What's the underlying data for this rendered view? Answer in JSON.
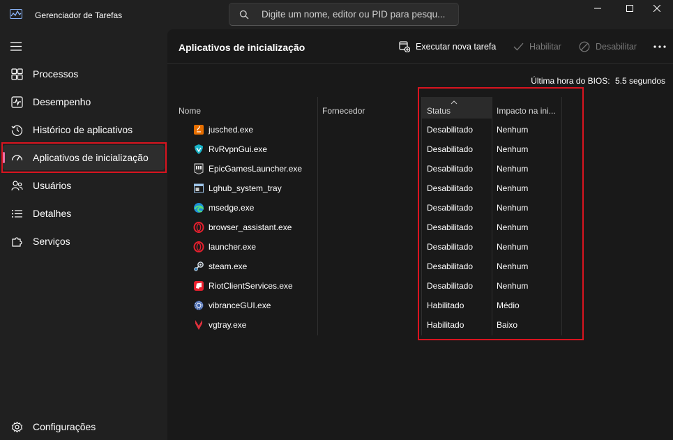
{
  "window": {
    "title": "Gerenciador de Tarefas",
    "search_placeholder": "Digite um nome, editor ou PID para pesqu..."
  },
  "sidebar": {
    "items": [
      {
        "label": "Processos",
        "icon": "grid-icon"
      },
      {
        "label": "Desempenho",
        "icon": "pulse-icon"
      },
      {
        "label": "Histórico de aplicativos",
        "icon": "history-icon"
      },
      {
        "label": "Aplicativos de inicialização",
        "icon": "speedometer-icon",
        "active": true
      },
      {
        "label": "Usuários",
        "icon": "users-icon"
      },
      {
        "label": "Detalhes",
        "icon": "list-icon"
      },
      {
        "label": "Serviços",
        "icon": "puzzle-icon"
      }
    ],
    "settings_label": "Configurações"
  },
  "toolbar": {
    "page_title": "Aplicativos de inicialização",
    "run_task_label": "Executar nova tarefa",
    "enable_label": "Habilitar",
    "disable_label": "Desabilitar"
  },
  "bios": {
    "label": "Última hora do BIOS:",
    "value": "5.5 segundos"
  },
  "table": {
    "columns": [
      "Nome",
      "Fornecedor",
      "Status",
      "Impacto na ini..."
    ],
    "sort_column": "Status",
    "rows": [
      {
        "name": "jusched.exe",
        "publisher": "",
        "status": "Desabilitado",
        "impact": "Nenhum",
        "icon": "java-icon"
      },
      {
        "name": "RvRvpnGui.exe",
        "publisher": "",
        "status": "Desabilitado",
        "impact": "Nenhum",
        "icon": "vpn-shield-icon"
      },
      {
        "name": "EpicGamesLauncher.exe",
        "publisher": "",
        "status": "Desabilitado",
        "impact": "Nenhum",
        "icon": "epic-games-icon"
      },
      {
        "name": "Lghub_system_tray",
        "publisher": "",
        "status": "Desabilitado",
        "impact": "Nenhum",
        "icon": "window-icon"
      },
      {
        "name": "msedge.exe",
        "publisher": "",
        "status": "Desabilitado",
        "impact": "Nenhum",
        "icon": "edge-icon"
      },
      {
        "name": "browser_assistant.exe",
        "publisher": "",
        "status": "Desabilitado",
        "impact": "Nenhum",
        "icon": "opera-icon"
      },
      {
        "name": "launcher.exe",
        "publisher": "",
        "status": "Desabilitado",
        "impact": "Nenhum",
        "icon": "opera-icon"
      },
      {
        "name": "steam.exe",
        "publisher": "",
        "status": "Desabilitado",
        "impact": "Nenhum",
        "icon": "steam-icon"
      },
      {
        "name": "RiotClientServices.exe",
        "publisher": "",
        "status": "Desabilitado",
        "impact": "Nenhum",
        "icon": "riot-icon"
      },
      {
        "name": "vibranceGUI.exe",
        "publisher": "",
        "status": "Habilitado",
        "impact": "Médio",
        "icon": "gear-badge-icon"
      },
      {
        "name": "vgtray.exe",
        "publisher": "",
        "status": "Habilitado",
        "impact": "Baixo",
        "icon": "vanguard-icon"
      }
    ]
  },
  "colors": {
    "annotation": "#d9141f",
    "active_indicator": "#e86fa6",
    "background": "#202020",
    "panel": "#191919"
  }
}
